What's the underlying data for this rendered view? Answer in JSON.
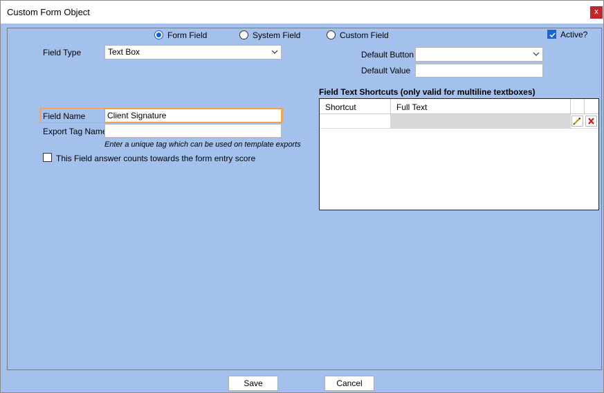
{
  "window": {
    "title": "Custom Form Object",
    "close_label": "x"
  },
  "source_options": [
    {
      "label": "Form Field",
      "selected": true
    },
    {
      "label": "System Field",
      "selected": false
    },
    {
      "label": "Custom Field",
      "selected": false
    }
  ],
  "active": {
    "label": "Active?",
    "checked": true
  },
  "field_type": {
    "label": "Field Type",
    "value": "Text Box"
  },
  "default_button": {
    "label": "Default Button",
    "value": ""
  },
  "default_value": {
    "label": "Default Value",
    "value": ""
  },
  "field_name": {
    "label": "Field Name",
    "value": "Client Signature"
  },
  "export_tag": {
    "label": "Export Tag Name",
    "value": "",
    "hint": "Enter a unique tag which can be used on template exports"
  },
  "score": {
    "label": "This Field answer counts towards the form entry score",
    "checked": false
  },
  "shortcuts": {
    "title": "Field Text Shortcuts (only valid for multiline textboxes)",
    "columns": [
      "Shortcut",
      "Full Text"
    ],
    "rows": [
      {
        "shortcut": "",
        "full_text": ""
      }
    ]
  },
  "footer": {
    "save_label": "Save",
    "cancel_label": "Cancel"
  },
  "icons": {
    "edit": "pencil-icon",
    "delete": "delete-x-icon",
    "dropdown": "chevron-down-icon",
    "check": "checkmark-icon"
  },
  "colors": {
    "background": "#a3c1ec",
    "accent": "#0f5fd6",
    "focus_border": "#f0a04b",
    "close_button": "#c0272d"
  }
}
